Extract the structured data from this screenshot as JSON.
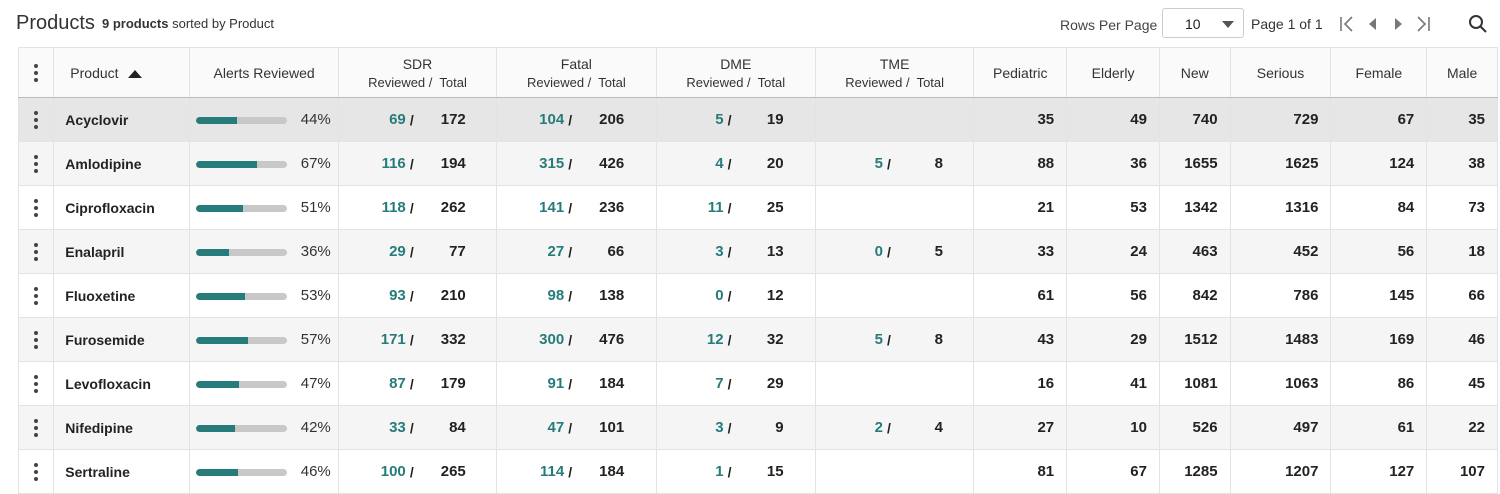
{
  "header": {
    "title": "Products",
    "count_text": "9 products",
    "sort_text": "sorted by Product",
    "rows_per_page_label": "Rows Per Page",
    "rows_per_page_value": "10",
    "page_info": "Page 1 of 1"
  },
  "columns": {
    "product": "Product",
    "alerts": "Alerts Reviewed",
    "sdr": "SDR",
    "fatal": "Fatal",
    "dme": "DME",
    "tme": "TME",
    "reviewed": "Reviewed /",
    "total": "Total",
    "pediatric": "Pediatric",
    "elderly": "Elderly",
    "new": "New",
    "serious": "Serious",
    "female": "Female",
    "male": "Male"
  },
  "rows": [
    {
      "product": "Acyclovir",
      "alerts_pct": 44,
      "alerts_label": "44%",
      "sdr_r": "69",
      "sdr_t": "172",
      "fatal_r": "104",
      "fatal_t": "206",
      "dme_r": "5",
      "dme_t": "19",
      "tme_r": "",
      "tme_t": "",
      "pediatric": "35",
      "elderly": "49",
      "new": "740",
      "serious": "729",
      "female": "67",
      "male": "35"
    },
    {
      "product": "Amlodipine",
      "alerts_pct": 67,
      "alerts_label": "67%",
      "sdr_r": "116",
      "sdr_t": "194",
      "fatal_r": "315",
      "fatal_t": "426",
      "dme_r": "4",
      "dme_t": "20",
      "tme_r": "5",
      "tme_t": "8",
      "pediatric": "88",
      "elderly": "36",
      "new": "1655",
      "serious": "1625",
      "female": "124",
      "male": "38"
    },
    {
      "product": "Ciprofloxacin",
      "alerts_pct": 51,
      "alerts_label": "51%",
      "sdr_r": "118",
      "sdr_t": "262",
      "fatal_r": "141",
      "fatal_t": "236",
      "dme_r": "11",
      "dme_t": "25",
      "tme_r": "",
      "tme_t": "",
      "pediatric": "21",
      "elderly": "53",
      "new": "1342",
      "serious": "1316",
      "female": "84",
      "male": "73"
    },
    {
      "product": "Enalapril",
      "alerts_pct": 36,
      "alerts_label": "36%",
      "sdr_r": "29",
      "sdr_t": "77",
      "fatal_r": "27",
      "fatal_t": "66",
      "dme_r": "3",
      "dme_t": "13",
      "tme_r": "0",
      "tme_t": "5",
      "pediatric": "33",
      "elderly": "24",
      "new": "463",
      "serious": "452",
      "female": "56",
      "male": "18"
    },
    {
      "product": "Fluoxetine",
      "alerts_pct": 53,
      "alerts_label": "53%",
      "sdr_r": "93",
      "sdr_t": "210",
      "fatal_r": "98",
      "fatal_t": "138",
      "dme_r": "0",
      "dme_t": "12",
      "tme_r": "",
      "tme_t": "",
      "pediatric": "61",
      "elderly": "56",
      "new": "842",
      "serious": "786",
      "female": "145",
      "male": "66"
    },
    {
      "product": "Furosemide",
      "alerts_pct": 57,
      "alerts_label": "57%",
      "sdr_r": "171",
      "sdr_t": "332",
      "fatal_r": "300",
      "fatal_t": "476",
      "dme_r": "12",
      "dme_t": "32",
      "tme_r": "5",
      "tme_t": "8",
      "pediatric": "43",
      "elderly": "29",
      "new": "1512",
      "serious": "1483",
      "female": "169",
      "male": "46"
    },
    {
      "product": "Levofloxacin",
      "alerts_pct": 47,
      "alerts_label": "47%",
      "sdr_r": "87",
      "sdr_t": "179",
      "fatal_r": "91",
      "fatal_t": "184",
      "dme_r": "7",
      "dme_t": "29",
      "tme_r": "",
      "tme_t": "",
      "pediatric": "16",
      "elderly": "41",
      "new": "1081",
      "serious": "1063",
      "female": "86",
      "male": "45"
    },
    {
      "product": "Nifedipine",
      "alerts_pct": 42,
      "alerts_label": "42%",
      "sdr_r": "33",
      "sdr_t": "84",
      "fatal_r": "47",
      "fatal_t": "101",
      "dme_r": "3",
      "dme_t": "9",
      "tme_r": "2",
      "tme_t": "4",
      "pediatric": "27",
      "elderly": "10",
      "new": "526",
      "serious": "497",
      "female": "61",
      "male": "22"
    },
    {
      "product": "Sertraline",
      "alerts_pct": 46,
      "alerts_label": "46%",
      "sdr_r": "100",
      "sdr_t": "265",
      "fatal_r": "114",
      "fatal_t": "184",
      "dme_r": "1",
      "dme_t": "15",
      "tme_r": "",
      "tme_t": "",
      "pediatric": "81",
      "elderly": "67",
      "new": "1285",
      "serious": "1207",
      "female": "127",
      "male": "107"
    }
  ],
  "colors": {
    "accent": "#267c7a",
    "bar_track": "#c8c8c8",
    "selected_row": "#e6e6e6",
    "alt_row": "#f5f5f5"
  },
  "icons": {
    "menu": "kebab-icon",
    "sort": "sort-ascending-icon",
    "search": "search-icon",
    "first": "first-page-icon",
    "prev": "previous-page-icon",
    "next": "next-page-icon",
    "last": "last-page-icon"
  }
}
